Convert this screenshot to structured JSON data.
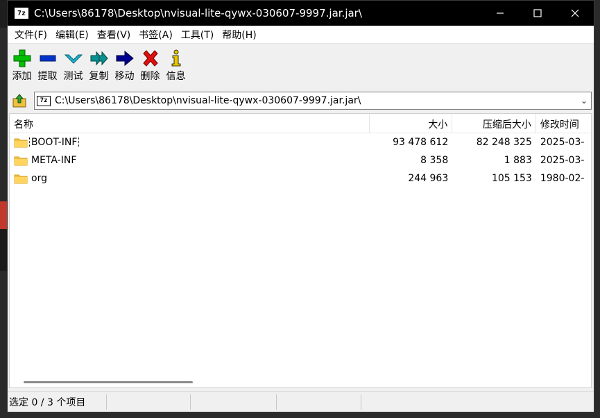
{
  "window": {
    "title": "C:\\Users\\86178\\Desktop\\nvisual-lite-qywx-030607-9997.jar.jar\\",
    "app_icon": "7z",
    "controls": [
      "minimize-icon",
      "maximize-icon",
      "close-icon"
    ]
  },
  "menu": {
    "items": [
      "文件(F)",
      "编辑(E)",
      "查看(V)",
      "书签(A)",
      "工具(T)",
      "帮助(H)"
    ]
  },
  "toolbar": {
    "tools": [
      {
        "label": "添加",
        "icon": "plus-icon",
        "color": "#00b000"
      },
      {
        "label": "提取",
        "icon": "minus-icon",
        "color": "#0033cc"
      },
      {
        "label": "测试",
        "icon": "check-icon",
        "color": "#00a0c0"
      },
      {
        "label": "复制",
        "icon": "double-arrow-icon",
        "color": "#008080"
      },
      {
        "label": "移动",
        "icon": "arrow-right-icon",
        "color": "#000080"
      },
      {
        "label": "删除",
        "icon": "delete-x-icon",
        "color": "#cc0000"
      },
      {
        "label": "信息",
        "icon": "info-icon",
        "color": "#e0c000"
      }
    ]
  },
  "address": {
    "path": "C:\\Users\\86178\\Desktop\\nvisual-lite-qywx-030607-9997.jar.jar\\"
  },
  "columns": {
    "name": "名称",
    "size": "大小",
    "packed": "压缩后大小",
    "modified": "修改时间"
  },
  "files": [
    {
      "name": "BOOT-INF",
      "size": "93 478 612",
      "packed": "82 248 325",
      "modified": "2025-03-"
    },
    {
      "name": "META-INF",
      "size": "8 358",
      "packed": "1 883",
      "modified": "2025-03-"
    },
    {
      "name": "org",
      "size": "244 963",
      "packed": "105 153",
      "modified": "1980-02-"
    }
  ],
  "status": {
    "selection": "选定 0 / 3 个项目"
  },
  "colors": {
    "titlebar": "#000000",
    "folder": "#f5c242"
  }
}
